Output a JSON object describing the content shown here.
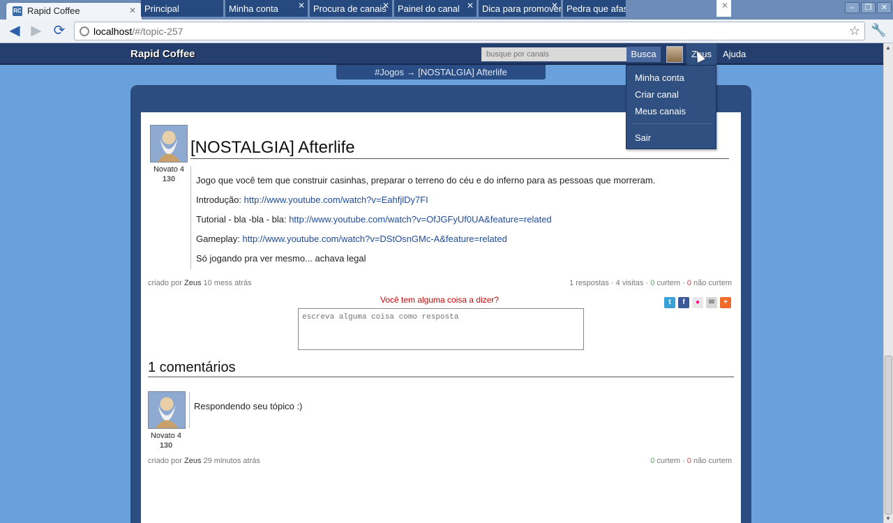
{
  "browser": {
    "tab_title": "Rapid Coffee",
    "tab_favicon": "RC",
    "url_host": "localhost",
    "url_path": "/#/topic-257"
  },
  "site": {
    "brand": "Rapid Coffee",
    "search_placeholder": "busque por canais",
    "search_button": "Busca",
    "user_menu": "Zeus",
    "help_menu": "Ajuda",
    "breadcrumb": "#Jogos → [NOSTALGIA] Afterlife"
  },
  "dropdown": {
    "items": [
      "Minha conta",
      "Criar canal",
      "Meus canais"
    ],
    "logout": "Sair"
  },
  "tabs": [
    {
      "label": "Principal",
      "closable": false
    },
    {
      "label": "Minha conta",
      "closable": true
    },
    {
      "label": "Procura de canais",
      "closable": true
    },
    {
      "label": "Painel do canal",
      "closable": true
    },
    {
      "label": "Dica para promover",
      "closable": true
    },
    {
      "label": "Pedra que afasta",
      "closable": true
    },
    {
      "label": "",
      "closable": true,
      "active": true
    }
  ],
  "topic": {
    "title": "[NOSTALGIA] Afterlife",
    "author_rank": "Novato 4",
    "author_score": "130",
    "body_intro": "Jogo que você tem que construir casinhas, preparar o terreno do céu e do inferno para as pessoas que morreram.",
    "lines": [
      {
        "label": "Introdução:",
        "link": "http://www.youtube.com/watch?v=EahfjlDy7FI"
      },
      {
        "label": "Tutorial - bla -bla - bla:",
        "link": "http://www.youtube.com/watch?v=OfJGFyUf0UA&feature=related"
      },
      {
        "label": "Gameplay:",
        "link": "http://www.youtube.com/watch?v=DStOsnGMc-A&feature=related"
      }
    ],
    "body_end": "Só jogando pra ver mesmo... achava legal",
    "created_by": "criado por",
    "author": "Zeus",
    "time": "10 mess atrás",
    "stats": {
      "responses": "1 respostas",
      "visits": "4 visitas",
      "likes": "0",
      "likes_label": "curtem",
      "dislikes": "0",
      "dislikes_label": "não curtem"
    }
  },
  "reply": {
    "prompt": "Você tem alguma coisa a dizer?",
    "placeholder": "escreva alguma coisa como resposta"
  },
  "comments": {
    "title": "1 comentários",
    "items": [
      {
        "rank": "Novato 4",
        "score": "130",
        "text": "Respondendo seu tópico :)",
        "created_by": "criado por",
        "author": "Zeus",
        "time": "29 minutos atrás",
        "likes": "0",
        "likes_label": "curtem",
        "dislikes": "0",
        "dislikes_label": "não curtem"
      }
    ]
  },
  "share_icons": [
    "twitter-icon",
    "facebook-icon",
    "flickr-icon",
    "email-icon",
    "more-icon"
  ],
  "colors": {
    "page_bg": "#6aa0dc",
    "header_bg": "#243e6e",
    "panel_bg": "#2c4d80",
    "link": "#1f4b9a",
    "like": "#4caf50",
    "dislike": "#e04040",
    "prompt": "#cc0000"
  }
}
